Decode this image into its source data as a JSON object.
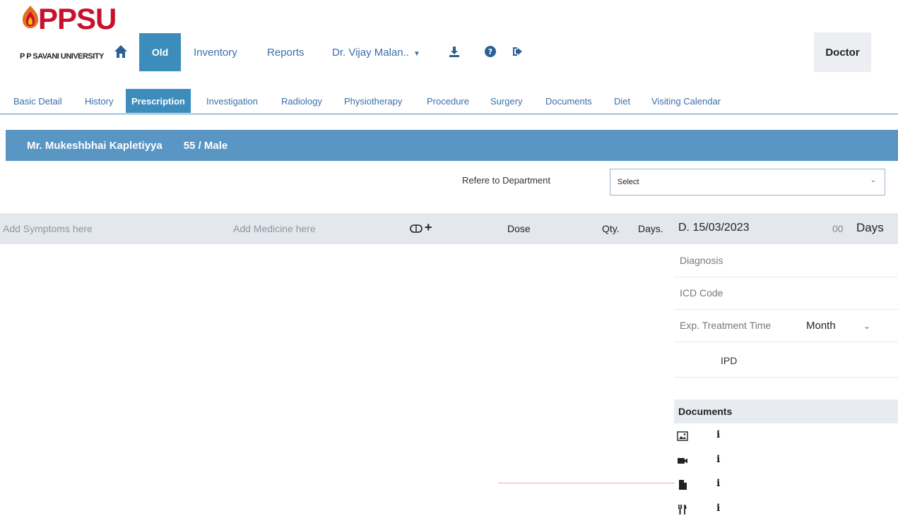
{
  "brand": {
    "name": "PPSU",
    "subtitle": "P P SAVANI UNIVERSITY"
  },
  "navbar": {
    "home_icon": "home-icon",
    "old_label": "Old",
    "inventory_label": "Inventory",
    "reports_label": "Reports",
    "doctor_label": "Dr. Vijay Malan..",
    "download_icon": "download-icon",
    "help_icon": "help-icon",
    "logout_icon": "logout-icon",
    "role_label": "Doctor"
  },
  "tabs": [
    {
      "label": "Basic Detail",
      "active": false
    },
    {
      "label": "History",
      "active": false
    },
    {
      "label": "Prescription",
      "active": true
    },
    {
      "label": "Investigation",
      "active": false
    },
    {
      "label": "Radiology",
      "active": false
    },
    {
      "label": "Physiotherapy",
      "active": false
    },
    {
      "label": "Procedure",
      "active": false
    },
    {
      "label": "Surgery",
      "active": false
    },
    {
      "label": "Documents",
      "active": false
    },
    {
      "label": "Diet",
      "active": false
    },
    {
      "label": "Visiting Calendar",
      "active": false
    }
  ],
  "patient": {
    "name": "Mr. Mukeshbhai Kapletiyya",
    "age_gender": "55 / Male"
  },
  "refer": {
    "label": "Refere to Department",
    "selected": "Select"
  },
  "prescription": {
    "symptoms_placeholder": "Add Symptoms here",
    "medicine_placeholder": "Add Medicine here",
    "pill_icon": "pill-icon",
    "plus_icon": "plus-icon",
    "dose_label": "Dose",
    "qty_label": "Qty.",
    "days_label": "Days.",
    "date": "D. 15/03/2023",
    "days_count": "00",
    "days_unit": "Days"
  },
  "side_panel": {
    "diagnosis_placeholder": "Diagnosis",
    "icd_placeholder": "ICD Code",
    "exp_label": "Exp. Treatment Time",
    "exp_value": "Month",
    "ipd_label": "IPD",
    "documents_title": "Documents",
    "documents": [
      {
        "icon": "image-icon",
        "info": "i"
      },
      {
        "icon": "video-icon",
        "info": "i"
      },
      {
        "icon": "file-icon",
        "info": "i"
      },
      {
        "icon": "utensils-icon",
        "info": "i"
      }
    ]
  },
  "colors": {
    "primary": "#3c8dbc",
    "banner": "#5a96c4",
    "brand_red": "#c8102e",
    "link": "#3a6fa8",
    "strip": "#e4e8ed"
  }
}
